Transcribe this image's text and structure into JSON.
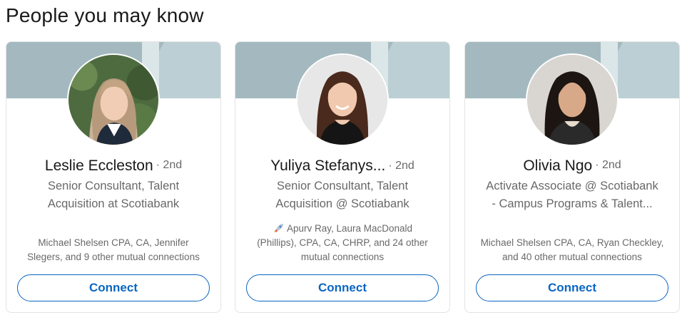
{
  "section_title": "People you may know",
  "colors": {
    "accent": "#0a66c2",
    "banner": "#bccfd5",
    "banner_dark": "#a3b9bf"
  },
  "cards": [
    {
      "name": "Leslie Eccleston",
      "degree": "· 2nd",
      "headline_lines": [
        "Senior Consultant, Talent",
        "Acquisition at Scotiabank"
      ],
      "mutual_lines": [
        "Michael Shelsen CPA, CA, Jennifer",
        "Slegers, and 9 other mutual connections"
      ],
      "connect_label": "Connect"
    },
    {
      "name": "Yuliya Stefanys...",
      "degree": "· 2nd",
      "headline_lines": [
        "Senior Consultant, Talent",
        "Acquisition @ Scotiabank"
      ],
      "mutual_icon": "rocket-emoji-icon",
      "mutual_lines": [
        "Apurv Ray, Laura MacDonald",
        "(Phillips), CPA, CA, CHRP, and 24 other",
        "mutual connections"
      ],
      "connect_label": "Connect"
    },
    {
      "name": "Olivia Ngo",
      "degree": "· 2nd",
      "headline_lines": [
        "Activate Associate @ Scotiabank",
        "- Campus Programs & Talent..."
      ],
      "mutual_lines": [
        "Michael Shelsen CPA, CA, Ryan Checkley,",
        "and 40 other mutual connections"
      ],
      "connect_label": "Connect"
    }
  ]
}
